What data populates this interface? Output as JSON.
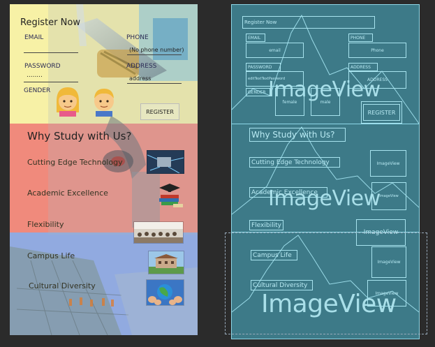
{
  "form": {
    "title": "Register Now",
    "email_label": "EMAIL",
    "phone_label": "PHONE",
    "phone_value": "(No phone number)",
    "password_label": "PASSWORD",
    "password_value": "........",
    "address_label": "ADDRESS",
    "address_value": "address",
    "gender_label": "GENDER",
    "register_label": "REGISTER"
  },
  "features": {
    "heading": "Why Study with Us?",
    "items": [
      {
        "label": "Cutting Edge Technology",
        "icon": "circuit-board-icon"
      },
      {
        "label": "Academic Excellence",
        "icon": "books-graduation-cap-icon"
      },
      {
        "label": "Flexibility",
        "icon": "classroom-photo-icon"
      },
      {
        "label": "Campus Life",
        "icon": "campus-building-icon"
      },
      {
        "label": "Cultural Diversity",
        "icon": "globe-hands-icon"
      }
    ]
  },
  "blueprint": {
    "register_now": "Register Now",
    "email": "EMAIL",
    "email_hint": "email",
    "phone": "PHONE",
    "phone_hint": "Phone",
    "password": "PASSWORD",
    "password_hint": "editTextTextPassword",
    "address": "ADDRESS",
    "address_hint": "ADDRESS",
    "gender": "GENDER",
    "female": "female",
    "male": "male",
    "register": "REGISTER",
    "why": "Why Study with Us?",
    "cutting": "Cutting Edge Technology",
    "academic": "Academic Excellence",
    "flex": "Flexibility",
    "campus": "Campus Life",
    "cultural": "Cultural Diversity",
    "imageview": "ImageView"
  },
  "colors": {
    "band_yellow": "#f7f1a6",
    "band_red": "#f08a7c",
    "band_blue": "#8aa3ee",
    "blueprint_bg": "#3d7a88",
    "blueprint_line": "#a8e4ef"
  }
}
